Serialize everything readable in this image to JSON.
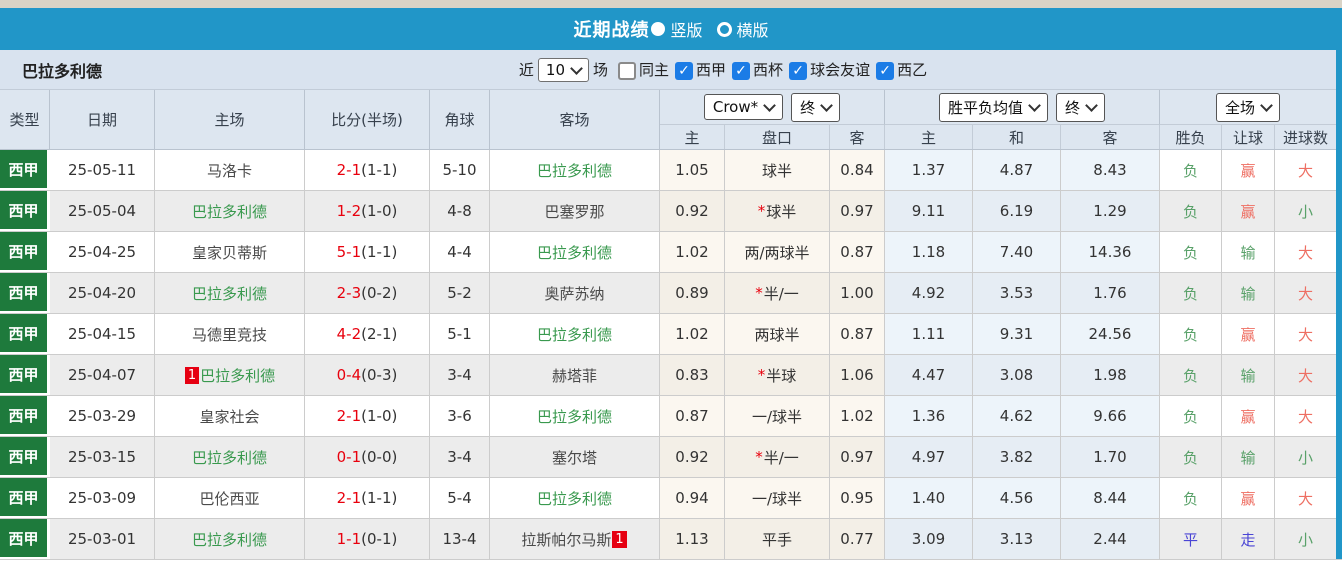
{
  "colors": {
    "top_bar_blue": "#2196c8",
    "checkbox_blue": "#1b7ce6",
    "league_green_bg": "#1e7a3c",
    "team_green": "#39994e",
    "score_red": "#e8000d",
    "result_red": "#ee6f63",
    "result_green": "#59a169",
    "result_blue": "#4a45d5",
    "badge_red": "#e60012",
    "header_bg": "#dde6f0",
    "filter_bg": "#d9e3ef",
    "alt_row_bg": "#ececec",
    "odds_col_bg": "#fbf7f0",
    "avg_col_bg": "#edf4fa"
  },
  "title_bar": {
    "title": "近期战绩",
    "radio_selected": "竖版",
    "radio_unselected": "横版"
  },
  "filter_bar": {
    "team": "巴拉多利德",
    "near": "近",
    "count": "10",
    "games": "场",
    "checkboxes": [
      {
        "label": "同主",
        "checked": false
      },
      {
        "label": "西甲",
        "checked": true
      },
      {
        "label": "西杯",
        "checked": true
      },
      {
        "label": "球会友谊",
        "checked": true
      },
      {
        "label": "西乙",
        "checked": true
      }
    ]
  },
  "header": {
    "static_cols": [
      "类型",
      "日期",
      "主场",
      "比分(半场)",
      "角球",
      "客场"
    ],
    "groups": [
      {
        "selects": [
          {
            "label": "Crow*",
            "name": "bookmaker-select"
          },
          {
            "label": "终",
            "name": "handicap-time-select"
          }
        ],
        "sub": [
          "主",
          "盘口",
          "客"
        ]
      },
      {
        "selects": [
          {
            "label": "胜平负均值",
            "name": "avg-odds-select"
          },
          {
            "label": "终",
            "name": "avg-time-select"
          }
        ],
        "sub": [
          "主",
          "和",
          "客"
        ]
      },
      {
        "selects": [
          {
            "label": "全场",
            "name": "full-match-select"
          }
        ],
        "sub": [
          "胜负",
          "让球",
          "进球数"
        ]
      }
    ]
  },
  "rows": [
    {
      "league": "西甲",
      "date": "25-05-11",
      "home": {
        "name": "马洛卡",
        "green": false
      },
      "score": "2-1",
      "half": "(1-1)",
      "corners": "5-10",
      "away": {
        "name": "巴拉多利德",
        "green": true
      },
      "o1": "1.05",
      "star": false,
      "hcp": "球半",
      "o2": "0.84",
      "a1": "1.37",
      "a2": "4.87",
      "a3": "8.43",
      "r1": {
        "t": "负",
        "c": "green"
      },
      "r2": {
        "t": "赢",
        "c": "red"
      },
      "r3": {
        "t": "大",
        "c": "red"
      }
    },
    {
      "league": "西甲",
      "date": "25-05-04",
      "home": {
        "name": "巴拉多利德",
        "green": true
      },
      "score": "1-2",
      "half": "(1-0)",
      "corners": "4-8",
      "away": {
        "name": "巴塞罗那",
        "green": false
      },
      "o1": "0.92",
      "star": true,
      "hcp": "球半",
      "o2": "0.97",
      "a1": "9.11",
      "a2": "6.19",
      "a3": "1.29",
      "r1": {
        "t": "负",
        "c": "green"
      },
      "r2": {
        "t": "赢",
        "c": "red"
      },
      "r3": {
        "t": "小",
        "c": "green"
      }
    },
    {
      "league": "西甲",
      "date": "25-04-25",
      "home": {
        "name": "皇家贝蒂斯",
        "green": false
      },
      "score": "5-1",
      "half": "(1-1)",
      "corners": "4-4",
      "away": {
        "name": "巴拉多利德",
        "green": true
      },
      "o1": "1.02",
      "star": false,
      "hcp": "两/两球半",
      "o2": "0.87",
      "a1": "1.18",
      "a2": "7.40",
      "a3": "14.36",
      "r1": {
        "t": "负",
        "c": "green"
      },
      "r2": {
        "t": "输",
        "c": "green"
      },
      "r3": {
        "t": "大",
        "c": "red"
      }
    },
    {
      "league": "西甲",
      "date": "25-04-20",
      "home": {
        "name": "巴拉多利德",
        "green": true
      },
      "score": "2-3",
      "half": "(0-2)",
      "corners": "5-2",
      "away": {
        "name": "奥萨苏纳",
        "green": false
      },
      "o1": "0.89",
      "star": true,
      "hcp": "半/一",
      "o2": "1.00",
      "a1": "4.92",
      "a2": "3.53",
      "a3": "1.76",
      "r1": {
        "t": "负",
        "c": "green"
      },
      "r2": {
        "t": "输",
        "c": "green"
      },
      "r3": {
        "t": "大",
        "c": "red"
      }
    },
    {
      "league": "西甲",
      "date": "25-04-15",
      "home": {
        "name": "马德里竞技",
        "green": false
      },
      "score": "4-2",
      "half": "(2-1)",
      "corners": "5-1",
      "away": {
        "name": "巴拉多利德",
        "green": true
      },
      "o1": "1.02",
      "star": false,
      "hcp": "两球半",
      "o2": "0.87",
      "a1": "1.11",
      "a2": "9.31",
      "a3": "24.56",
      "r1": {
        "t": "负",
        "c": "green"
      },
      "r2": {
        "t": "赢",
        "c": "red"
      },
      "r3": {
        "t": "大",
        "c": "red"
      }
    },
    {
      "league": "西甲",
      "date": "25-04-07",
      "home": {
        "name": "巴拉多利德",
        "green": true,
        "badge": "1",
        "badge_pos": "before"
      },
      "score": "0-4",
      "half": "(0-3)",
      "corners": "3-4",
      "away": {
        "name": "赫塔菲",
        "green": false
      },
      "o1": "0.83",
      "star": true,
      "hcp": "半球",
      "o2": "1.06",
      "a1": "4.47",
      "a2": "3.08",
      "a3": "1.98",
      "r1": {
        "t": "负",
        "c": "green"
      },
      "r2": {
        "t": "输",
        "c": "green"
      },
      "r3": {
        "t": "大",
        "c": "red"
      }
    },
    {
      "league": "西甲",
      "date": "25-03-29",
      "home": {
        "name": "皇家社会",
        "green": false
      },
      "score": "2-1",
      "half": "(1-0)",
      "corners": "3-6",
      "away": {
        "name": "巴拉多利德",
        "green": true
      },
      "o1": "0.87",
      "star": false,
      "hcp": "一/球半",
      "o2": "1.02",
      "a1": "1.36",
      "a2": "4.62",
      "a3": "9.66",
      "r1": {
        "t": "负",
        "c": "green"
      },
      "r2": {
        "t": "赢",
        "c": "red"
      },
      "r3": {
        "t": "大",
        "c": "red"
      }
    },
    {
      "league": "西甲",
      "date": "25-03-15",
      "home": {
        "name": "巴拉多利德",
        "green": true
      },
      "score": "0-1",
      "half": "(0-0)",
      "corners": "3-4",
      "away": {
        "name": "塞尔塔",
        "green": false
      },
      "o1": "0.92",
      "star": true,
      "hcp": "半/一",
      "o2": "0.97",
      "a1": "4.97",
      "a2": "3.82",
      "a3": "1.70",
      "r1": {
        "t": "负",
        "c": "green"
      },
      "r2": {
        "t": "输",
        "c": "green"
      },
      "r3": {
        "t": "小",
        "c": "green"
      }
    },
    {
      "league": "西甲",
      "date": "25-03-09",
      "home": {
        "name": "巴伦西亚",
        "green": false
      },
      "score": "2-1",
      "half": "(1-1)",
      "corners": "5-4",
      "away": {
        "name": "巴拉多利德",
        "green": true
      },
      "o1": "0.94",
      "star": false,
      "hcp": "一/球半",
      "o2": "0.95",
      "a1": "1.40",
      "a2": "4.56",
      "a3": "8.44",
      "r1": {
        "t": "负",
        "c": "green"
      },
      "r2": {
        "t": "赢",
        "c": "red"
      },
      "r3": {
        "t": "大",
        "c": "red"
      }
    },
    {
      "league": "西甲",
      "date": "25-03-01",
      "home": {
        "name": "巴拉多利德",
        "green": true
      },
      "score": "1-1",
      "half": "(0-1)",
      "corners": "13-4",
      "away": {
        "name": "拉斯帕尔马斯",
        "green": false,
        "badge": "1",
        "badge_pos": "after"
      },
      "o1": "1.13",
      "star": false,
      "hcp": "平手",
      "o2": "0.77",
      "a1": "3.09",
      "a2": "3.13",
      "a3": "2.44",
      "r1": {
        "t": "平",
        "c": "blue"
      },
      "r2": {
        "t": "走",
        "c": "blue"
      },
      "r3": {
        "t": "小",
        "c": "green"
      }
    }
  ]
}
